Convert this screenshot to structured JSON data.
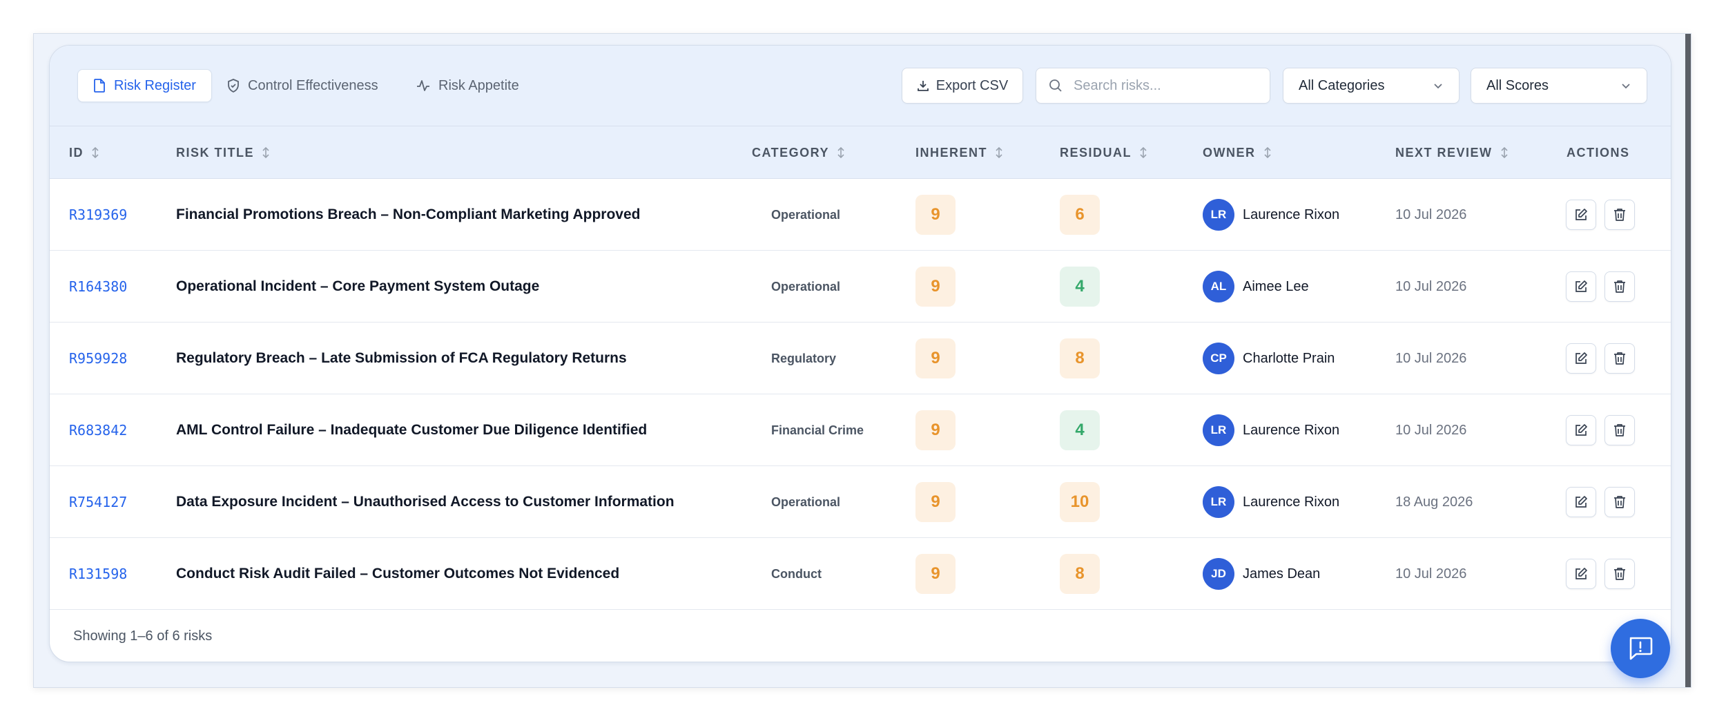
{
  "tabs": [
    {
      "label": "Risk Register",
      "icon": "document-icon"
    },
    {
      "label": "Control Effectiveness",
      "icon": "shield-icon"
    },
    {
      "label": "Risk Appetite",
      "icon": "activity-icon"
    }
  ],
  "toolbar": {
    "export_label": "Export CSV",
    "search_placeholder": "Search risks...",
    "category_filter": "All Categories",
    "score_filter": "All Scores"
  },
  "table": {
    "columns": [
      "ID",
      "RISK TITLE",
      "CATEGORY",
      "INHERENT",
      "RESIDUAL",
      "OWNER",
      "NEXT REVIEW",
      "ACTIONS"
    ],
    "rows": [
      {
        "id": "R319369",
        "title": "Financial Promotions Breach – Non-Compliant Marketing Approved",
        "category": "Operational",
        "inherent": "9",
        "residual": "6",
        "owner_initials": "LR",
        "owner": "Laurence Rixon",
        "next_review": "10 Jul 2026"
      },
      {
        "id": "R164380",
        "title": "Operational Incident – Core Payment System Outage",
        "category": "Operational",
        "inherent": "9",
        "residual": "4",
        "owner_initials": "AL",
        "owner": "Aimee Lee",
        "next_review": "10 Jul 2026"
      },
      {
        "id": "R959928",
        "title": "Regulatory Breach – Late Submission of FCA Regulatory Returns",
        "category": "Regulatory",
        "inherent": "9",
        "residual": "8",
        "owner_initials": "CP",
        "owner": "Charlotte Prain",
        "next_review": "10 Jul 2026"
      },
      {
        "id": "R683842",
        "title": "AML Control Failure – Inadequate Customer Due Diligence Identified",
        "category": "Financial Crime",
        "inherent": "9",
        "residual": "4",
        "owner_initials": "LR",
        "owner": "Laurence Rixon",
        "next_review": "10 Jul 2026"
      },
      {
        "id": "R754127",
        "title": "Data Exposure Incident – Unauthorised Access to Customer Information",
        "category": "Operational",
        "inherent": "9",
        "residual": "10",
        "owner_initials": "LR",
        "owner": "Laurence Rixon",
        "next_review": "18 Aug 2026"
      },
      {
        "id": "R131598",
        "title": "Conduct Risk Audit Failed – Customer Outcomes Not Evidenced",
        "category": "Conduct",
        "inherent": "9",
        "residual": "8",
        "owner_initials": "JD",
        "owner": "James Dean",
        "next_review": "10 Jul 2026"
      }
    ]
  },
  "footer": {
    "summary": "Showing 1–6 of 6 risks"
  },
  "colors": {
    "accent": "#2563eb",
    "score_amber": "#e8942c",
    "score_green": "#34a86a",
    "avatar": "#2f5fd8"
  }
}
